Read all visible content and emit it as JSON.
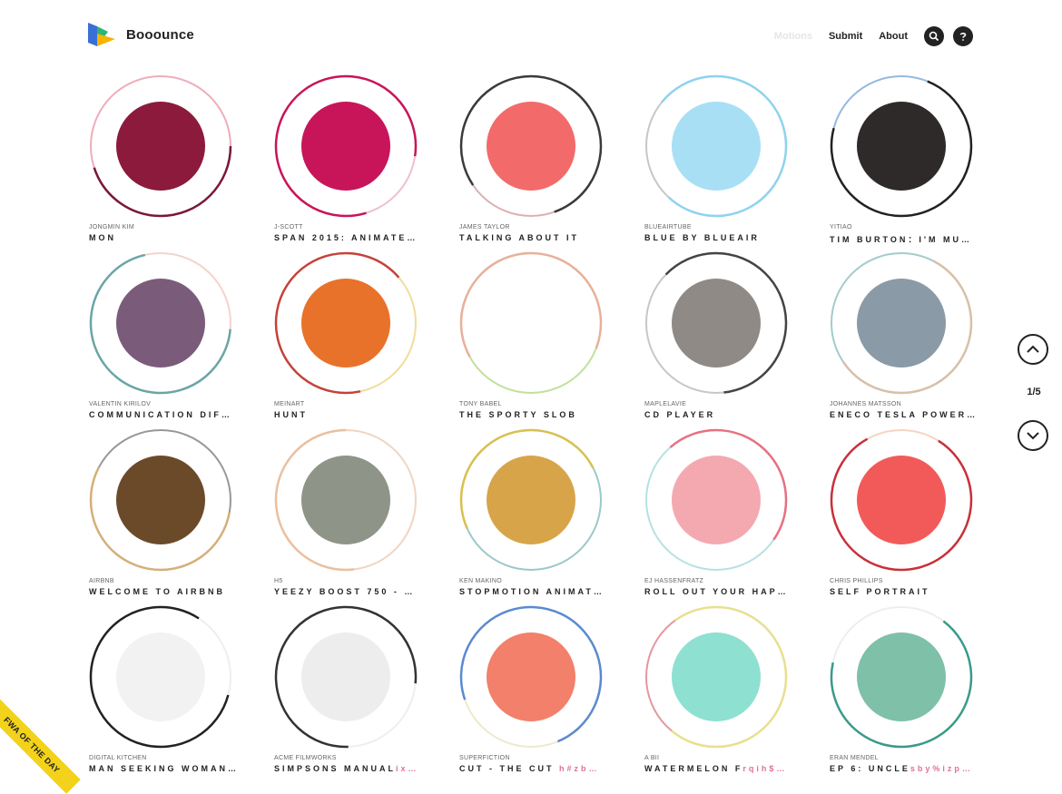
{
  "app": {
    "name": "Booounce",
    "logo_colors": [
      "#3a6fd8",
      "#f5b400",
      "#2bb673"
    ]
  },
  "nav": {
    "motions": "Motions",
    "submit": "Submit",
    "about": "About",
    "search_icon": "search-icon",
    "help_icon": "help-icon"
  },
  "pager": {
    "label": "1/5",
    "up_icon": "chevron-up-icon",
    "down_icon": "chevron-down-icon"
  },
  "ribbon": {
    "text": "FWA OF THE DAY"
  },
  "cards": [
    {
      "author": "JONGMIN KIM",
      "title": "MON",
      "thumb": "#8b1a3c",
      "ring": [
        "#7a1838",
        "#e06a82"
      ]
    },
    {
      "author": "J-SCOTT",
      "title": "SPAN 2015: ANIMATE…",
      "thumb": "#c8155a",
      "ring": [
        "#c8155a",
        "#e28aa5"
      ]
    },
    {
      "author": "JAMES TAYLOR",
      "title": "TALKING ABOUT IT",
      "thumb": "#f26a6a",
      "ring": [
        "#3a3a3a",
        "#c07070"
      ]
    },
    {
      "author": "BLUEAIRTUBE",
      "title": "BLUE BY BLUEAIR",
      "thumb": "#a8dff5",
      "ring": [
        "#8dd3ef",
        "#999999"
      ]
    },
    {
      "author": "YITIAO",
      "title": "TIM BURTON：I'M MU…",
      "thumb": "#2f2a2a",
      "ring": [
        "#222222",
        "#3a7fc5"
      ]
    },
    {
      "author": "VALENTIN KIRILOV",
      "title": "COMMUNICATION DIF…",
      "thumb": "#7a5c7a",
      "ring": [
        "#6ba5a5",
        "#e7b0a0"
      ]
    },
    {
      "author": "MEINART",
      "title": "HUNT",
      "thumb": "#e8722a",
      "ring": [
        "#c5423a",
        "#e8c04a"
      ]
    },
    {
      "author": "TONY BABEL",
      "title": "THE SPORTY SLOB",
      "thumb": "#ffffff",
      "ring": [
        "#e8b09a",
        "#8cc94a"
      ]
    },
    {
      "author": "MAPLELAVIE",
      "title": "CD PLAYER",
      "thumb": "#8f8a86",
      "ring": [
        "#444444",
        "#999999"
      ]
    },
    {
      "author": "JOHANNES MATSSON",
      "title": "ENECO TESLA POWER…",
      "thumb": "#8a9aa6",
      "ring": [
        "#d8c0a8",
        "#5aa0a0"
      ]
    },
    {
      "author": "AIRBNB",
      "title": "WELCOME TO AIRBNB",
      "thumb": "#6b4a2a",
      "ring": [
        "#d4b07a",
        "#444444"
      ]
    },
    {
      "author": "H5",
      "title": "YEEZY BOOST 750 - …",
      "thumb": "#8f9488",
      "ring": [
        "#eac0a0",
        "#e8b090"
      ]
    },
    {
      "author": "KEN MAKINO",
      "title": "STOPMOTION ANIMAT…",
      "thumb": "#d8a44a",
      "ring": [
        "#d8c050",
        "#4a9a9a"
      ]
    },
    {
      "author": "EJ HASSENFRATZ",
      "title": "ROLL OUT YOUR HAP…",
      "thumb": "#f4a8b0",
      "ring": [
        "#e87080",
        "#7ac8c8"
      ]
    },
    {
      "author": "CHRIS PHILLIPS",
      "title": "SELF PORTRAIT",
      "thumb": "#f25a5a",
      "ring": [
        "#c8303a",
        "#f0b090"
      ]
    },
    {
      "author": "DIGITAL KITCHEN",
      "title": "MAN SEEKING WOMAN…",
      "thumb": "#f2f2f2",
      "ring": [
        "#222222",
        "#e0e0e0"
      ]
    },
    {
      "author": "ACME FILMWORKS",
      "title": "SIMPSONS MANUAL",
      "title_extra": "ix…",
      "thumb": "#ededed",
      "ring": [
        "#333333",
        "#e0e0e0"
      ]
    },
    {
      "author": "SUPERFICTION",
      "title": "CUT - THE CUT ",
      "title_extra": "h#zb…",
      "thumb": "#f2806a",
      "ring": [
        "#5a8ad0",
        "#e0d8a0"
      ]
    },
    {
      "author": "A BII",
      "title": "WATERMELON F",
      "title_extra": "rqih$…",
      "thumb": "#8ee0d0",
      "ring": [
        "#e8e090",
        "#d04050"
      ]
    },
    {
      "author": "ERAN MENDEL",
      "title": "EP 6: UNCLE",
      "title_extra": "sby%izp…",
      "thumb": "#7ec0a8",
      "ring": [
        "#3a9a8a",
        "#e0e0e0"
      ]
    }
  ]
}
